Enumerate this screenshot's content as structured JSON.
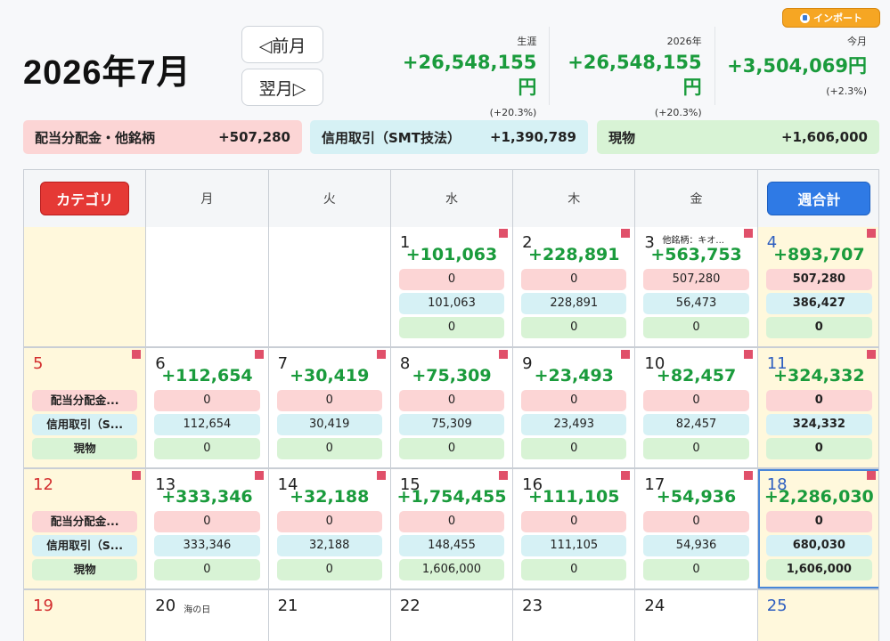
{
  "import_label": "インポート",
  "month_title": "2026年7月",
  "nav": {
    "prev": "◁前月",
    "next": "翌月▷"
  },
  "stats": [
    {
      "label": "生涯",
      "value": "+26,548,155円",
      "pct": "(+20.3%)"
    },
    {
      "label": "2026年",
      "value": "+26,548,155円",
      "pct": "(+20.3%)"
    },
    {
      "label": "今月",
      "value": "+3,504,069円",
      "pct": "(+2.3%)"
    }
  ],
  "categories": [
    {
      "name": "配当分配金・他銘柄",
      "value": "+507,280"
    },
    {
      "name": "信用取引（SMT技法）",
      "value": "+1,390,789"
    },
    {
      "name": "現物",
      "value": "+1,606,000"
    }
  ],
  "header": {
    "category_button": "カテゴリ",
    "days": [
      "月",
      "火",
      "水",
      "木",
      "金"
    ],
    "week_total_button": "週合計"
  },
  "row_labels": [
    "配当分配金...",
    "信用取引（S...",
    "現物"
  ],
  "weeks": [
    {
      "sun": {
        "day": "",
        "show_labels": false
      },
      "days": [
        {
          "day": ""
        },
        {
          "day": ""
        },
        {
          "day": "1",
          "total": "+101,063",
          "v": [
            "0",
            "101,063",
            "0"
          ]
        },
        {
          "day": "2",
          "total": "+228,891",
          "v": [
            "0",
            "228,891",
            "0"
          ]
        },
        {
          "day": "3",
          "note": "他銘柄：キオ...",
          "total": "+563,753",
          "v": [
            "507,280",
            "56,473",
            "0"
          ]
        }
      ],
      "sum": {
        "day": "4",
        "total": "+893,707",
        "v": [
          "507,280",
          "386,427",
          "0"
        ]
      }
    },
    {
      "sun": {
        "day": "5",
        "show_labels": true
      },
      "days": [
        {
          "day": "6",
          "total": "+112,654",
          "v": [
            "0",
            "112,654",
            "0"
          ]
        },
        {
          "day": "7",
          "total": "+30,419",
          "v": [
            "0",
            "30,419",
            "0"
          ]
        },
        {
          "day": "8",
          "total": "+75,309",
          "v": [
            "0",
            "75,309",
            "0"
          ]
        },
        {
          "day": "9",
          "total": "+23,493",
          "v": [
            "0",
            "23,493",
            "0"
          ]
        },
        {
          "day": "10",
          "total": "+82,457",
          "v": [
            "0",
            "82,457",
            "0"
          ]
        }
      ],
      "sum": {
        "day": "11",
        "total": "+324,332",
        "v": [
          "0",
          "324,332",
          "0"
        ]
      }
    },
    {
      "sun": {
        "day": "12",
        "show_labels": true
      },
      "days": [
        {
          "day": "13",
          "total": "+333,346",
          "v": [
            "0",
            "333,346",
            "0"
          ]
        },
        {
          "day": "14",
          "total": "+32,188",
          "v": [
            "0",
            "32,188",
            "0"
          ]
        },
        {
          "day": "15",
          "total": "+1,754,455",
          "v": [
            "0",
            "148,455",
            "1,606,000"
          ]
        },
        {
          "day": "16",
          "total": "+111,105",
          "v": [
            "0",
            "111,105",
            "0"
          ]
        },
        {
          "day": "17",
          "total": "+54,936",
          "v": [
            "0",
            "54,936",
            "0"
          ]
        }
      ],
      "sum": {
        "day": "18",
        "total": "+2,286,030",
        "v": [
          "0",
          "680,030",
          "1,606,000"
        ],
        "selected": true
      }
    },
    {
      "sun": {
        "day": "19",
        "show_labels": false
      },
      "days": [
        {
          "day": "20",
          "holiday": "海の日"
        },
        {
          "day": "21"
        },
        {
          "day": "22"
        },
        {
          "day": "23"
        },
        {
          "day": "24"
        }
      ],
      "sum": {
        "day": "25"
      }
    }
  ],
  "colors": {
    "positive": "#1a9b3c",
    "dividend": "#fcd5d5",
    "margin": "#d6f1f5",
    "spot": "#d8f3d5",
    "sunday": "#d32f2f",
    "saturday": "#2f5fc0",
    "flag": "#e0506a"
  }
}
